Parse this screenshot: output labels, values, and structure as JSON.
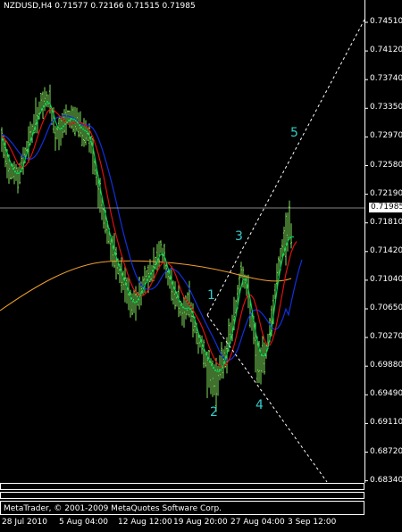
{
  "header": {
    "title": "NZDUSD,H4  0.71577 0.72166 0.71515 0.71985"
  },
  "price_axis": {
    "labels": [
      "0.74510",
      "0.74120",
      "0.73740",
      "0.73350",
      "0.72970",
      "0.72580",
      "0.72190",
      "0.71810",
      "0.71420",
      "0.71040",
      "0.70650",
      "0.70270",
      "0.69880",
      "0.69490",
      "0.69110",
      "0.68720",
      "0.68340"
    ],
    "current_price": "0.71985"
  },
  "wave_labels": [
    "1",
    "2",
    "3",
    "4",
    "5"
  ],
  "footer": {
    "copyright": "MetaTrader, © 2001-2009 MetaQuotes Software Corp.",
    "time_labels": [
      "28 Jul 2010",
      "5 Aug 04:00",
      "12 Aug 12:00",
      "19 Aug 20:00",
      "27 Aug 04:00",
      "3 Sep 12:00"
    ]
  },
  "colors": {
    "bars": "#7fe05a",
    "ma_fast": "#00d050",
    "ma_red": "#e01010",
    "ma_blue": "#1030e0",
    "ma_orange": "#f0a030",
    "wave_labels": "#33cccc",
    "trendlines": "#ffffff"
  },
  "chart_data": {
    "type": "candlestick",
    "symbol": "NZDUSD",
    "timeframe": "H4",
    "open": 0.71577,
    "high": 0.72166,
    "low": 0.71515,
    "close": 0.71985,
    "ylim": [
      0.6834,
      0.7451
    ],
    "overlays": [
      "fast moving average (green)",
      "moving average (red)",
      "moving average (blue)",
      "long moving average (orange)",
      "dotted trend lines",
      "wave count 1-5"
    ]
  }
}
